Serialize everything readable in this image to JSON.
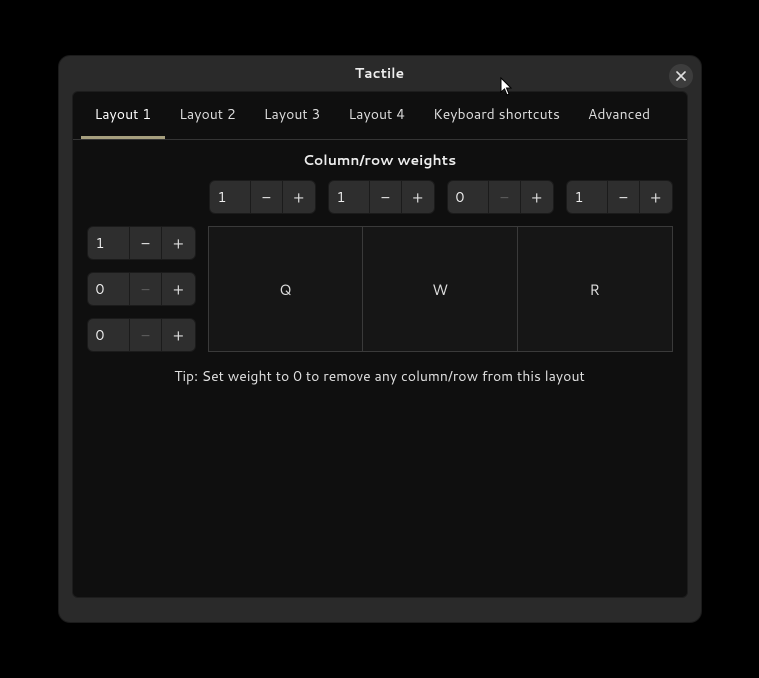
{
  "window": {
    "title": "Tactile"
  },
  "tabs": [
    {
      "label": "Layout 1",
      "active": true
    },
    {
      "label": "Layout 2",
      "active": false
    },
    {
      "label": "Layout 3",
      "active": false
    },
    {
      "label": "Layout 4",
      "active": false
    },
    {
      "label": "Keyboard shortcuts",
      "active": false
    },
    {
      "label": "Advanced",
      "active": false
    }
  ],
  "section_title": "Column/row weights",
  "columns": [
    {
      "value": "1",
      "minus_disabled": false
    },
    {
      "value": "1",
      "minus_disabled": false
    },
    {
      "value": "0",
      "minus_disabled": true
    },
    {
      "value": "1",
      "minus_disabled": false
    }
  ],
  "rows": [
    {
      "value": "1",
      "minus_disabled": false
    },
    {
      "value": "0",
      "minus_disabled": true
    },
    {
      "value": "0",
      "minus_disabled": true
    }
  ],
  "cells": [
    "Q",
    "W",
    "R"
  ],
  "tip": "Tip: Set weight to 0 to remove any column/row from this layout",
  "glyphs": {
    "minus": "−",
    "plus": "+"
  }
}
